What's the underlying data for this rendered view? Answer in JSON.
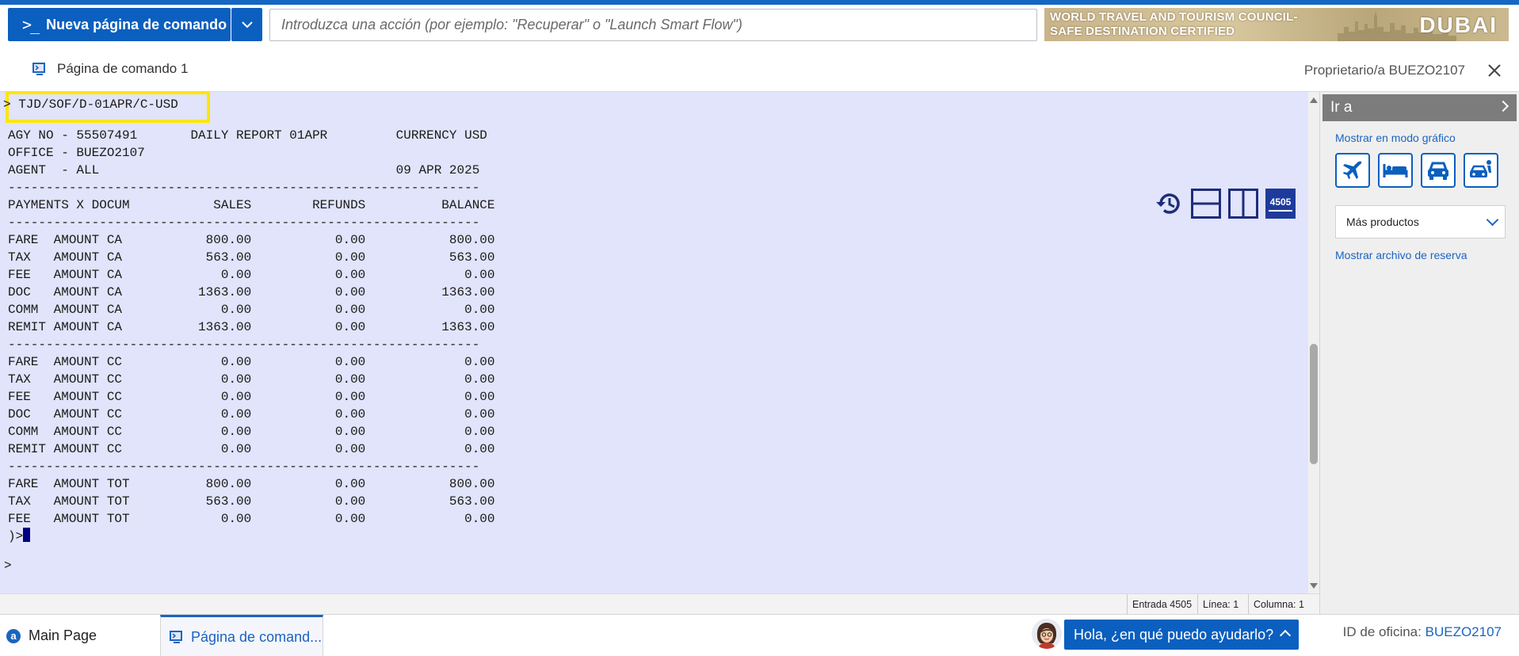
{
  "toolbar": {
    "new_command_label": "Nueva página de comando",
    "command_input_placeholder": "Introduzca una acción (por ejemplo: \"Recuperar\" o \"Launch Smart Flow\")"
  },
  "banner": {
    "line1": "WORLD TRAVEL AND TOURISM COUNCIL-",
    "line2": "SAFE DESTINATION CERTIFIED",
    "brand": "DUBAI"
  },
  "page_tab": {
    "title": "Página de comando 1",
    "owner": "Proprietario/a BUEZO2107"
  },
  "terminal": {
    "highlighted_command": "> TJD/SOF/D-01APR/C-USD",
    "report_text": "AGY NO - 55507491       DAILY REPORT 01APR         CURRENCY USD\nOFFICE - BUEZO2107\nAGENT  - ALL                                       09 APR 2025\n--------------------------------------------------------------\nPAYMENTS X DOCUM           SALES        REFUNDS          BALANCE\n--------------------------------------------------------------\nFARE  AMOUNT CA           800.00           0.00           800.00\nTAX   AMOUNT CA           563.00           0.00           563.00\nFEE   AMOUNT CA             0.00           0.00             0.00\nDOC   AMOUNT CA          1363.00           0.00          1363.00\nCOMM  AMOUNT CA             0.00           0.00             0.00\nREMIT AMOUNT CA          1363.00           0.00          1363.00\n--------------------------------------------------------------\nFARE  AMOUNT CC             0.00           0.00             0.00\nTAX   AMOUNT CC             0.00           0.00             0.00\nFEE   AMOUNT CC             0.00           0.00             0.00\nDOC   AMOUNT CC             0.00           0.00             0.00\nCOMM  AMOUNT CC             0.00           0.00             0.00\nREMIT AMOUNT CC             0.00           0.00             0.00\n--------------------------------------------------------------\nFARE  AMOUNT TOT          800.00           0.00           800.00\nTAX   AMOUNT TOT          563.00           0.00           563.00\nFEE   AMOUNT TOT            0.00           0.00             0.00",
    "end_prompt": ")>",
    "input_prompt": ">",
    "counter_badge": "4505",
    "tool_icons": [
      "history-icon",
      "split-horizontal-icon",
      "split-vertical-icon",
      "entry-counter-icon"
    ]
  },
  "status_bar": {
    "entrada": "Entrada 4505",
    "linea": "Línea: 1",
    "columna": "Columna: 1"
  },
  "right_panel": {
    "goto_label": "Ir a",
    "graphic_mode_link": "Mostrar en modo gráfico",
    "product_icons": [
      "flight-icon",
      "hotel-icon",
      "car-icon",
      "transfer-icon"
    ],
    "more_products_label": "Más productos",
    "booking_file_link": "Mostrar archivo de reserva"
  },
  "bottom_bar": {
    "main_tab": "Main Page",
    "command_tab": "Página de comand...",
    "help_label": "Hola, ¿en qué puedo ayudarlo?",
    "office_label": "ID de oficina:",
    "office_value": "BUEZO2107"
  },
  "colors": {
    "primary": "#0a5fbf",
    "terminal_bg": "#e1e4fa",
    "highlight": "#ffe600",
    "link": "#1b64c0"
  }
}
